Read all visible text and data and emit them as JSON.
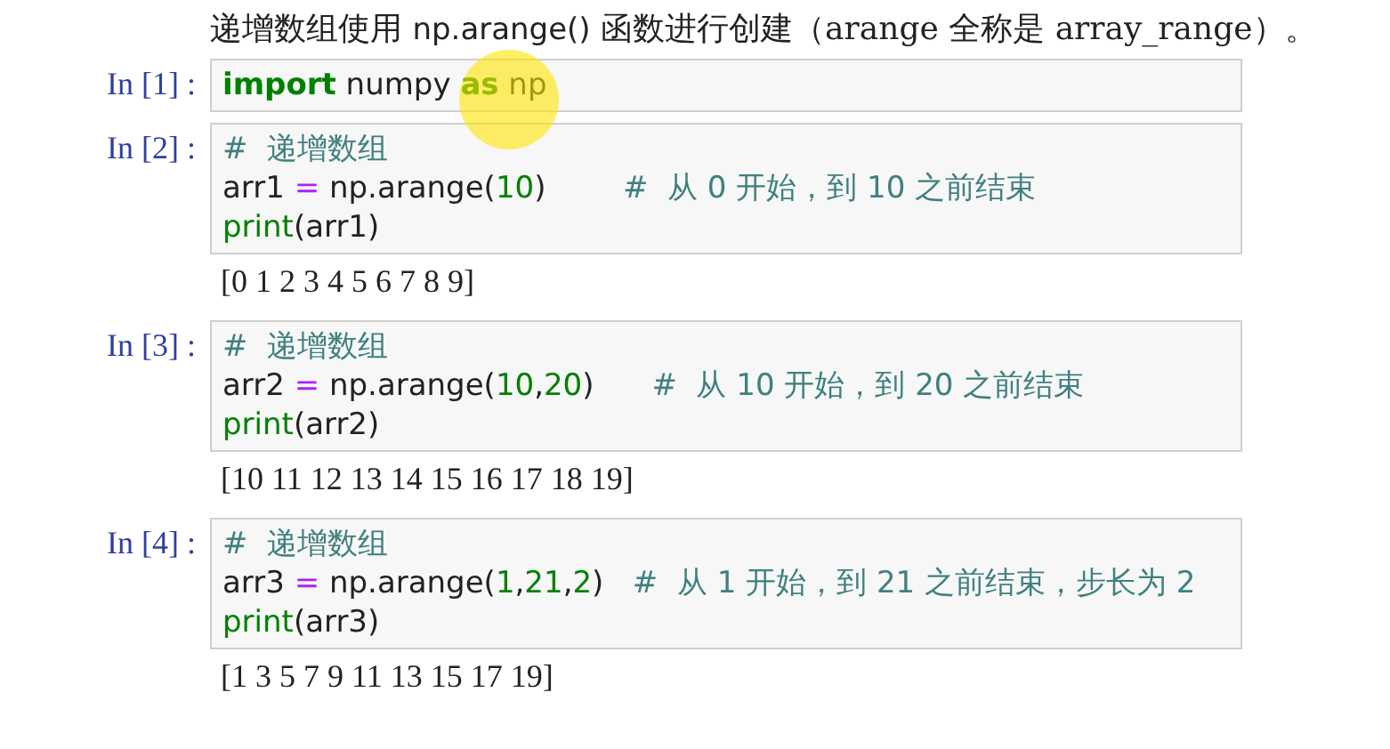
{
  "intro": [
    {
      "kind": "text",
      "text": "递增数组使用 "
    },
    {
      "kind": "code",
      "text": "np.arange()"
    },
    {
      "kind": "text",
      "text": " 函数进行创建（arange 全称是 array_range）。"
    }
  ],
  "cells": [
    {
      "prompt": "In [1] :",
      "lines": [
        [
          {
            "kind": "keyword",
            "text": "import"
          },
          {
            "kind": "plain",
            "text": " numpy "
          },
          {
            "kind": "keyword",
            "text": "as"
          },
          {
            "kind": "plain",
            "text": " np"
          }
        ]
      ]
    },
    {
      "prompt": "In [2] :",
      "lines": [
        [
          {
            "kind": "comment",
            "text": "#  递增数组"
          }
        ],
        [
          {
            "kind": "plain",
            "text": "arr1 "
          },
          {
            "kind": "op",
            "text": "="
          },
          {
            "kind": "plain",
            "text": " np.arange("
          },
          {
            "kind": "number",
            "text": "10"
          },
          {
            "kind": "plain",
            "text": ")        "
          },
          {
            "kind": "comment",
            "text": "#  从 0 开始，到 10 之前结束"
          }
        ],
        [
          {
            "kind": "builtin",
            "text": "print"
          },
          {
            "kind": "plain",
            "text": "(arr1)"
          }
        ]
      ],
      "output": "[0 1 2 3 4 5 6 7 8 9]"
    },
    {
      "prompt": "In [3] :",
      "lines": [
        [
          {
            "kind": "comment",
            "text": "#  递增数组"
          }
        ],
        [
          {
            "kind": "plain",
            "text": "arr2 "
          },
          {
            "kind": "op",
            "text": "="
          },
          {
            "kind": "plain",
            "text": " np.arange("
          },
          {
            "kind": "number",
            "text": "10"
          },
          {
            "kind": "plain",
            "text": ","
          },
          {
            "kind": "number",
            "text": "20"
          },
          {
            "kind": "plain",
            "text": ")      "
          },
          {
            "kind": "comment",
            "text": "#  从 10 开始，到 20 之前结束"
          }
        ],
        [
          {
            "kind": "builtin",
            "text": "print"
          },
          {
            "kind": "plain",
            "text": "(arr2)"
          }
        ]
      ],
      "output": "[10 11 12 13 14 15 16 17 18 19]"
    },
    {
      "prompt": "In [4] :",
      "lines": [
        [
          {
            "kind": "comment",
            "text": "#  递增数组"
          }
        ],
        [
          {
            "kind": "plain",
            "text": "arr3 "
          },
          {
            "kind": "op",
            "text": "="
          },
          {
            "kind": "plain",
            "text": " np.arange("
          },
          {
            "kind": "number",
            "text": "1"
          },
          {
            "kind": "plain",
            "text": ","
          },
          {
            "kind": "number",
            "text": "21"
          },
          {
            "kind": "plain",
            "text": ","
          },
          {
            "kind": "number",
            "text": "2"
          },
          {
            "kind": "plain",
            "text": ")   "
          },
          {
            "kind": "comment",
            "text": "#  从 1 开始，到 21 之前结束，步长为 2"
          }
        ],
        [
          {
            "kind": "builtin",
            "text": "print"
          },
          {
            "kind": "plain",
            "text": "(arr3)"
          }
        ]
      ],
      "output": "[1 3 5 7 9 11 13 15 17 19]"
    }
  ]
}
